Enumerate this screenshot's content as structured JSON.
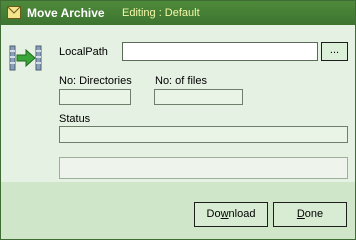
{
  "window": {
    "title": "Move Archive",
    "subtitle": "Editing : Default"
  },
  "form": {
    "local_path_label": "LocalPath",
    "local_path_value": "",
    "browse_label": "...",
    "dirs_label": "No: Directories",
    "dirs_value": "",
    "files_label": "No: of files",
    "files_value": "",
    "status_label": "Status",
    "status_value": "",
    "progress": 0
  },
  "buttons": {
    "download_pre": "Do",
    "download_accel": "w",
    "download_post": "nload",
    "done_pre": "",
    "done_accel": "D",
    "done_post": "one"
  },
  "colors": {
    "titlebar": "#3d7430",
    "title_subtitle": "#f5f7a8",
    "body": "#e5f1e2",
    "footer": "#cfe6c9"
  },
  "icons": {
    "title": "mail-envelope-icon",
    "app": "archive-arrow-icon"
  }
}
